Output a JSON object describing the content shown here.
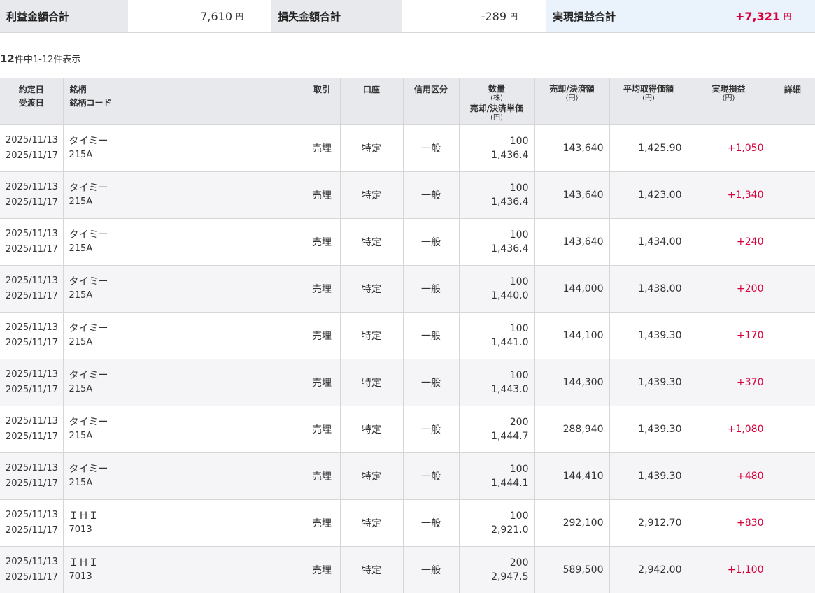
{
  "summary": {
    "profit_label": "利益金額合計",
    "profit_value": "7,610",
    "loss_label": "損失金額合計",
    "loss_value": "-289",
    "total_label": "実現損益合計",
    "total_value": "+7,321",
    "unit": "円"
  },
  "count": {
    "total": "12",
    "text": "件中1-12件表示"
  },
  "headers": {
    "date1": "約定日",
    "date2": "受渡日",
    "name1": "銘柄",
    "name2": "銘柄コード",
    "trade": "取引",
    "account": "口座",
    "credit": "信用区分",
    "qty": "数量",
    "qty_unit": "(株)",
    "unit_price": "売却/決済単価",
    "yen": "(円)",
    "amount": "売却/決済額",
    "avg": "平均取得価額",
    "pl": "実現損益",
    "detail": "詳細"
  },
  "rows": [
    {
      "trade_date": "2025/11/13",
      "settle_date": "2025/11/17",
      "name": "タイミー",
      "code": "215A",
      "trade": "売埋",
      "account": "特定",
      "credit": "一般",
      "qty": "100",
      "unit_price": "1,436.4",
      "amount": "143,640",
      "avg": "1,425.90",
      "pl": "+1,050"
    },
    {
      "trade_date": "2025/11/13",
      "settle_date": "2025/11/17",
      "name": "タイミー",
      "code": "215A",
      "trade": "売埋",
      "account": "特定",
      "credit": "一般",
      "qty": "100",
      "unit_price": "1,436.4",
      "amount": "143,640",
      "avg": "1,423.00",
      "pl": "+1,340"
    },
    {
      "trade_date": "2025/11/13",
      "settle_date": "2025/11/17",
      "name": "タイミー",
      "code": "215A",
      "trade": "売埋",
      "account": "特定",
      "credit": "一般",
      "qty": "100",
      "unit_price": "1,436.4",
      "amount": "143,640",
      "avg": "1,434.00",
      "pl": "+240"
    },
    {
      "trade_date": "2025/11/13",
      "settle_date": "2025/11/17",
      "name": "タイミー",
      "code": "215A",
      "trade": "売埋",
      "account": "特定",
      "credit": "一般",
      "qty": "100",
      "unit_price": "1,440.0",
      "amount": "144,000",
      "avg": "1,438.00",
      "pl": "+200"
    },
    {
      "trade_date": "2025/11/13",
      "settle_date": "2025/11/17",
      "name": "タイミー",
      "code": "215A",
      "trade": "売埋",
      "account": "特定",
      "credit": "一般",
      "qty": "100",
      "unit_price": "1,441.0",
      "amount": "144,100",
      "avg": "1,439.30",
      "pl": "+170"
    },
    {
      "trade_date": "2025/11/13",
      "settle_date": "2025/11/17",
      "name": "タイミー",
      "code": "215A",
      "trade": "売埋",
      "account": "特定",
      "credit": "一般",
      "qty": "100",
      "unit_price": "1,443.0",
      "amount": "144,300",
      "avg": "1,439.30",
      "pl": "+370"
    },
    {
      "trade_date": "2025/11/13",
      "settle_date": "2025/11/17",
      "name": "タイミー",
      "code": "215A",
      "trade": "売埋",
      "account": "特定",
      "credit": "一般",
      "qty": "200",
      "unit_price": "1,444.7",
      "amount": "288,940",
      "avg": "1,439.30",
      "pl": "+1,080"
    },
    {
      "trade_date": "2025/11/13",
      "settle_date": "2025/11/17",
      "name": "タイミー",
      "code": "215A",
      "trade": "売埋",
      "account": "特定",
      "credit": "一般",
      "qty": "100",
      "unit_price": "1,444.1",
      "amount": "144,410",
      "avg": "1,439.30",
      "pl": "+480"
    },
    {
      "trade_date": "2025/11/13",
      "settle_date": "2025/11/17",
      "name": "ＩＨＩ",
      "code": "7013",
      "trade": "売埋",
      "account": "特定",
      "credit": "一般",
      "qty": "100",
      "unit_price": "2,921.0",
      "amount": "292,100",
      "avg": "2,912.70",
      "pl": "+830"
    },
    {
      "trade_date": "2025/11/13",
      "settle_date": "2025/11/17",
      "name": "ＩＨＩ",
      "code": "7013",
      "trade": "売埋",
      "account": "特定",
      "credit": "一般",
      "qty": "200",
      "unit_price": "2,947.5",
      "amount": "589,500",
      "avg": "2,942.00",
      "pl": "+1,100"
    }
  ],
  "colors": {
    "profit": "#d8003a",
    "header_bg": "#e8e9ed",
    "total_bg": "#eaf3fc"
  }
}
